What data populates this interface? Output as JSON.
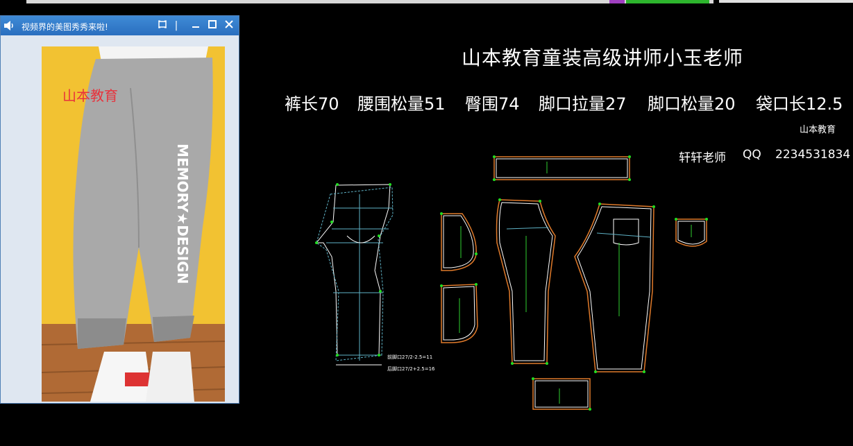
{
  "popup": {
    "title": "视频界的美图秀秀来啦!",
    "photo_text": "山本教育",
    "pants_print": "MEMORY★DESIGN"
  },
  "header": {
    "main_title": "山本教育童装高级讲师小玉老师",
    "specs": [
      "裤长70",
      "腰围松量51",
      "臀围74",
      "脚口拉量27",
      "脚口松量20",
      "袋口长12.5"
    ],
    "brand": "山本教育",
    "teacher": "轩轩老师",
    "qq_label": "QQ",
    "qq_number": "2234531834"
  },
  "notes": {
    "front_hem": "前脚口27/2-2.5=11",
    "back_hem": "后脚口27/2+2.5=16"
  },
  "colors": {
    "outline": "#ffffff",
    "seam": "#e07a2a",
    "grainline": "#2fd12f",
    "construction": "#5fb3c7",
    "point": "#22dd22"
  },
  "icons": [
    "speaker-icon",
    "fit-window-icon",
    "minimize-icon",
    "maximize-icon",
    "close-icon"
  ]
}
